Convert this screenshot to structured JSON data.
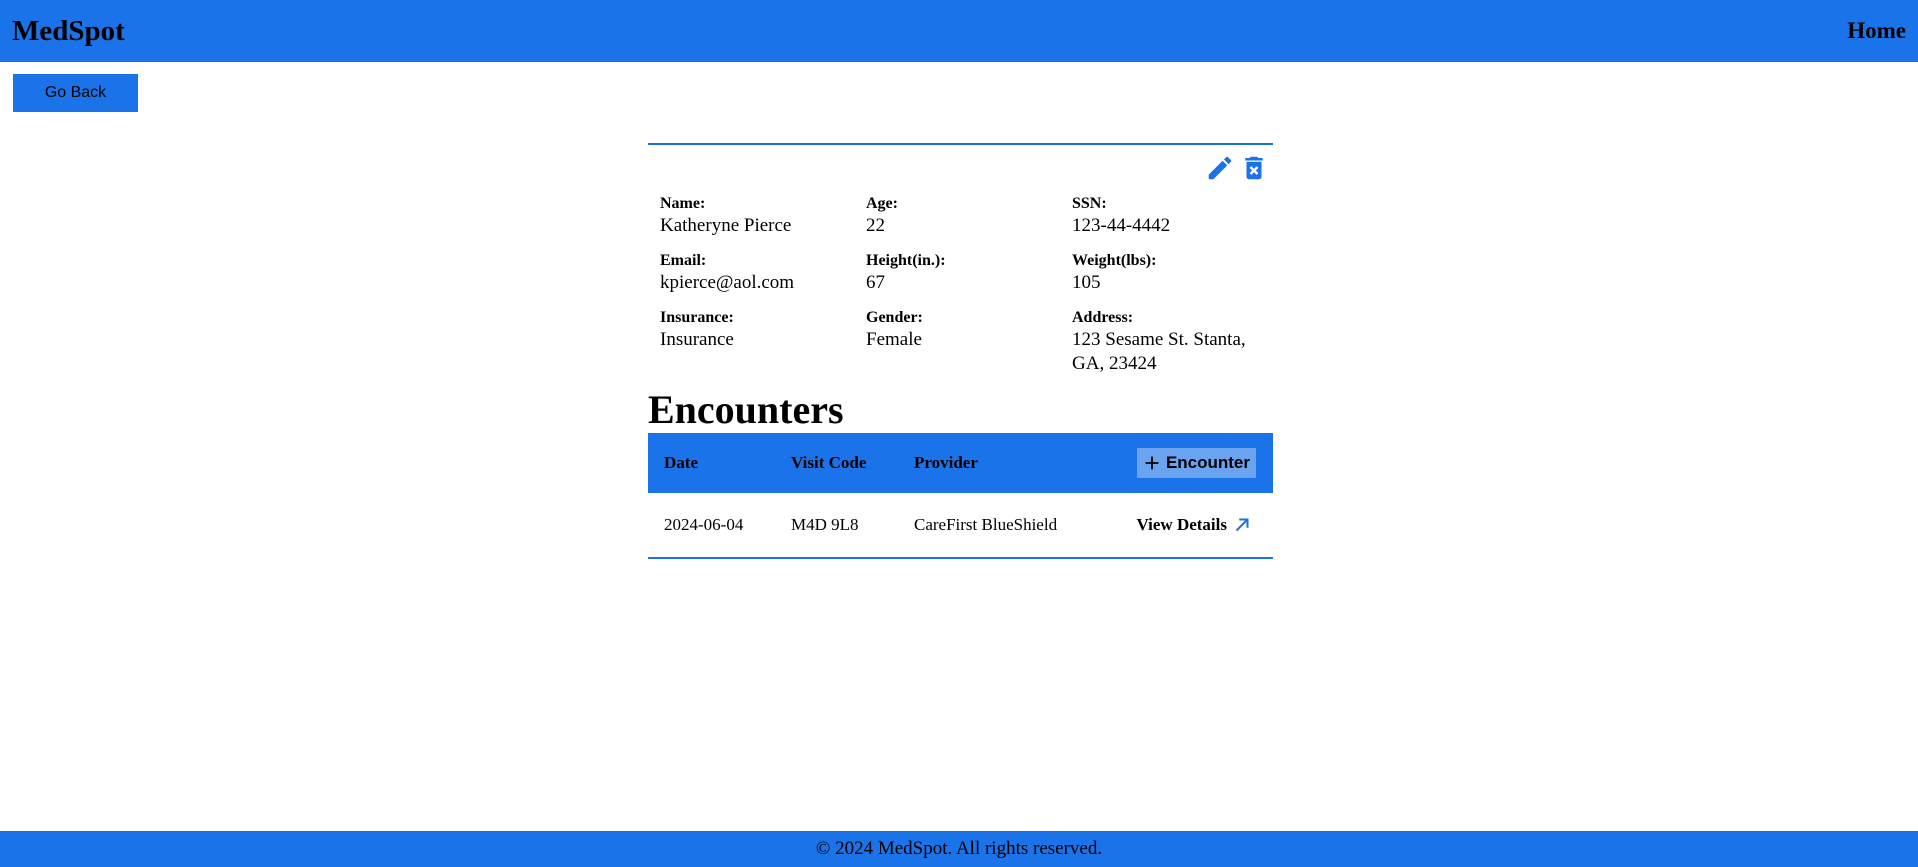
{
  "navbar": {
    "brand": "MedSpot",
    "home_link": "Home"
  },
  "go_back_label": "Go Back",
  "patient": {
    "fields": [
      {
        "label": "Name:",
        "value": "Katheryne Pierce"
      },
      {
        "label": "Age:",
        "value": "22"
      },
      {
        "label": "SSN:",
        "value": "123-44-4442"
      },
      {
        "label": "Email:",
        "value": "kpierce@aol.com"
      },
      {
        "label": "Height(in.):",
        "value": "67"
      },
      {
        "label": "Weight(lbs):",
        "value": "105"
      },
      {
        "label": "Insurance:",
        "value": "Insurance"
      },
      {
        "label": "Gender:",
        "value": "Female"
      },
      {
        "label": "Address:",
        "value": "123 Sesame St. Stanta, GA, 23424"
      }
    ]
  },
  "encounters": {
    "title": "Encounters",
    "columns": [
      "Date",
      "Visit Code",
      "Provider"
    ],
    "add_button_label": "Encounter",
    "rows": [
      {
        "date": "2024-06-04",
        "visit_code": "M4D 9L8",
        "provider": "CareFirst BlueShield",
        "action_label": "View Details"
      }
    ]
  },
  "footer": {
    "text": "© 2024 MedSpot. All rights reserved."
  },
  "colors": {
    "primary": "#1a73e8",
    "button_light": "#6aa3f0"
  },
  "icons": {
    "edit": "pencil-icon",
    "delete": "trash-icon",
    "add": "plus-icon",
    "open": "arrow-up-right-icon"
  }
}
